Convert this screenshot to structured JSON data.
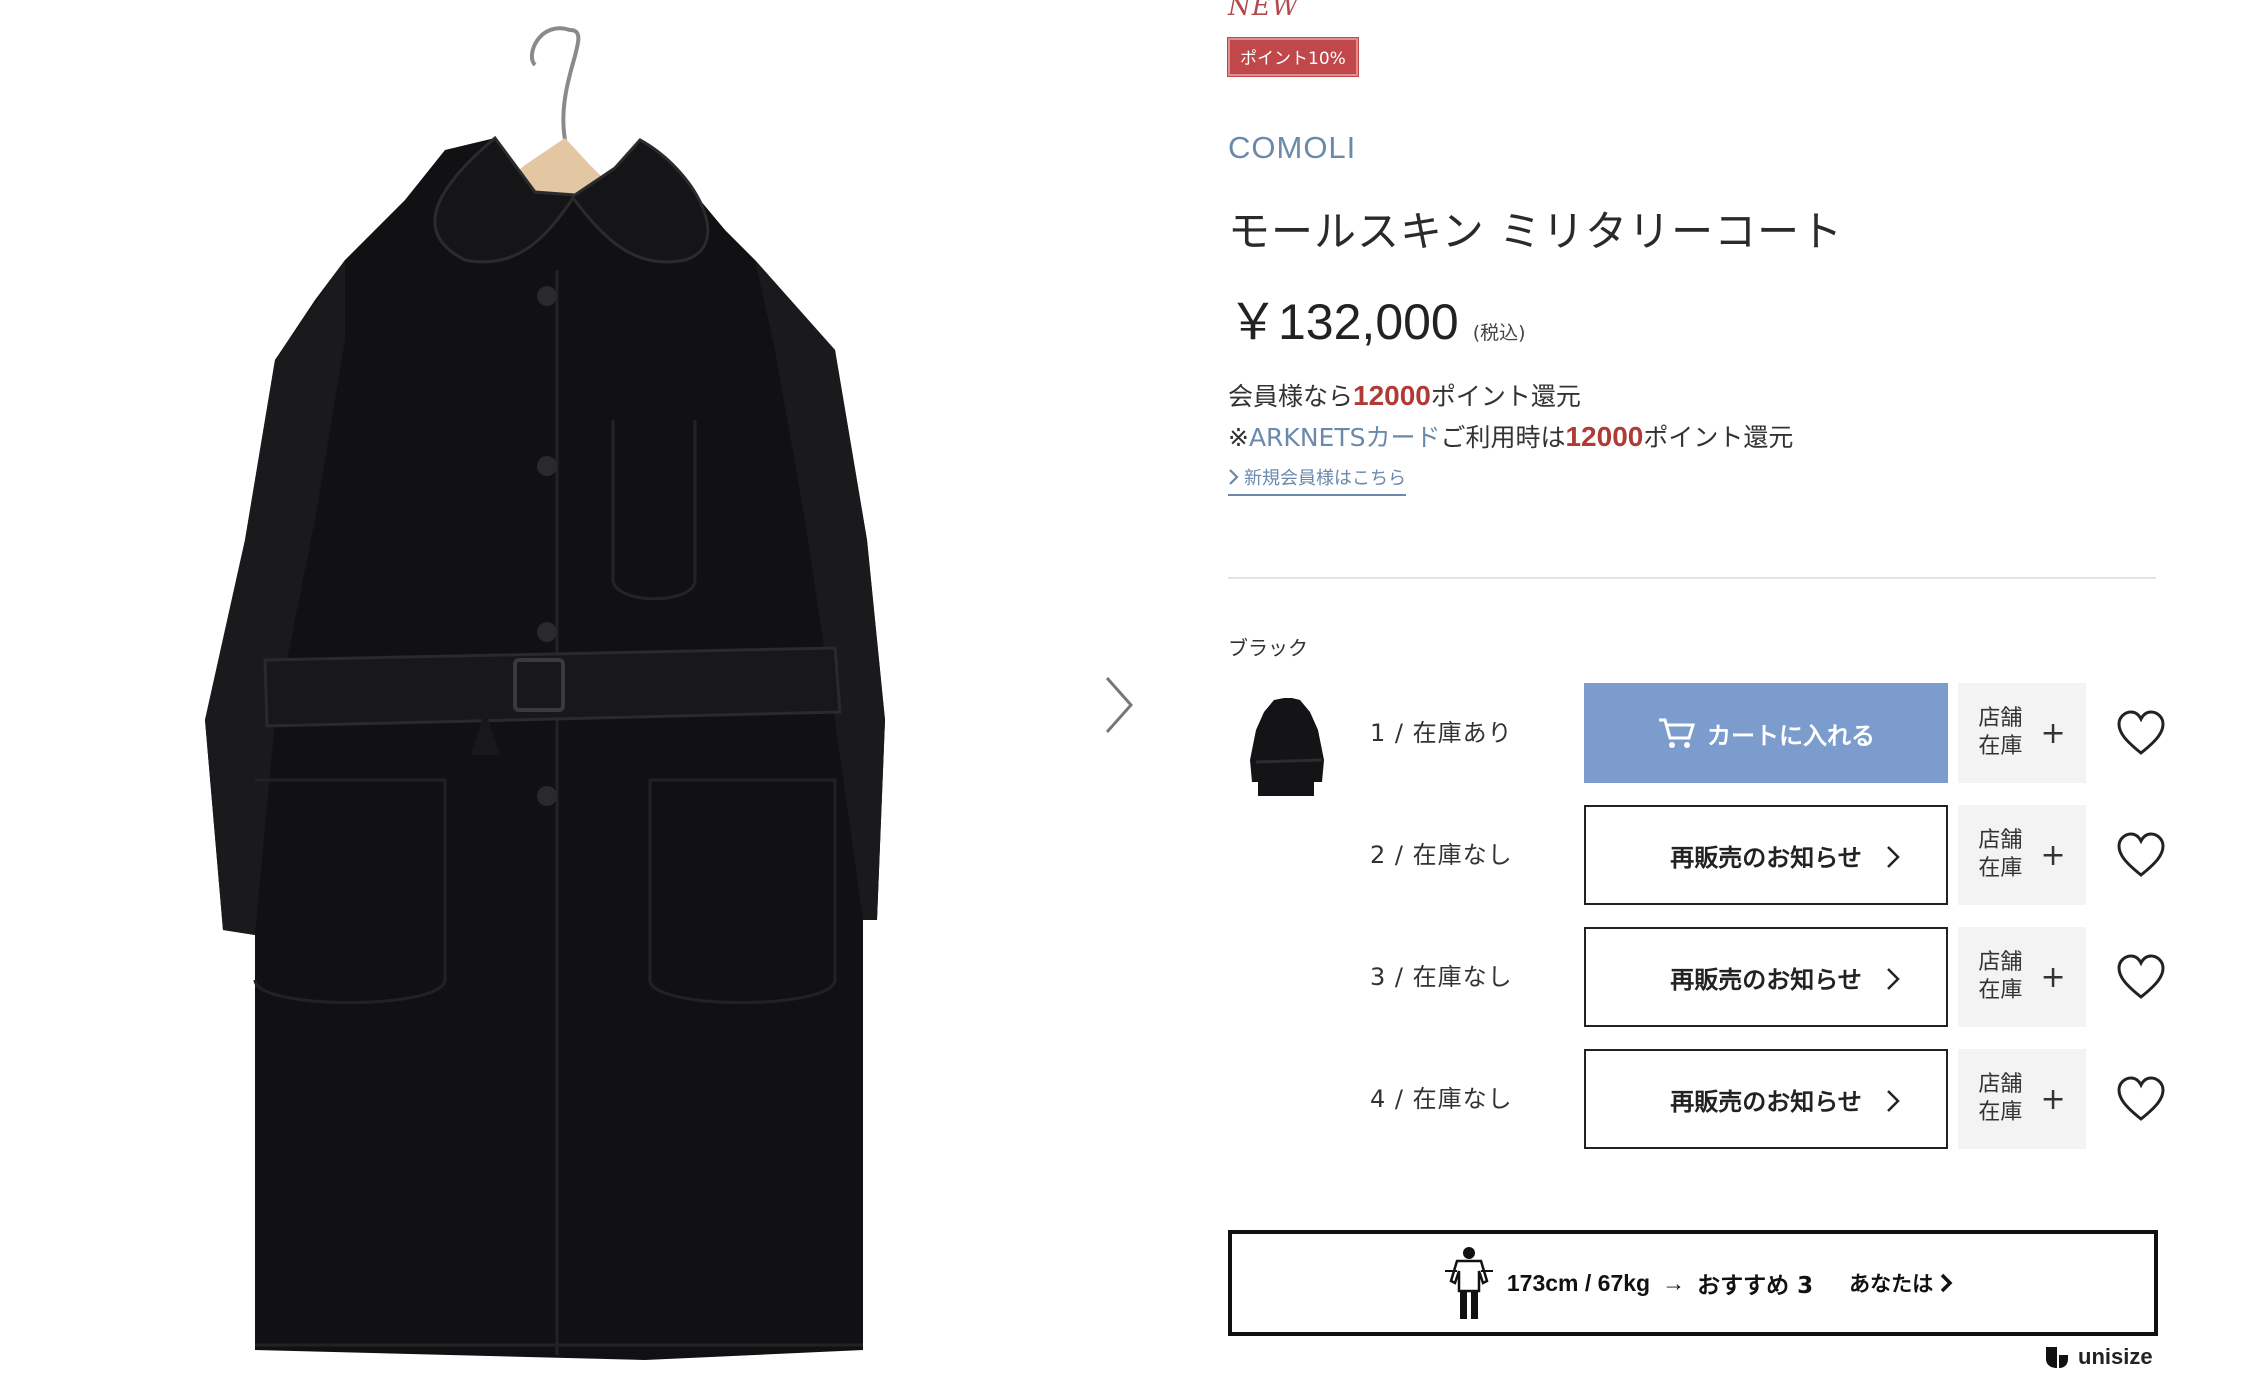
{
  "product": {
    "new_label": "NEW",
    "point_badge": "ポイント10%",
    "brand": "COMOLI",
    "title": "モールスキン ミリタリーコート",
    "price": "￥132,000",
    "tax_note": "(税込)"
  },
  "points": {
    "line1_prefix": "会員様なら",
    "line1_value": "12000",
    "line1_suffix": "ポイント還元",
    "line2_prefix": "※",
    "line2_card": "ARKNETSカード",
    "line2_mid": "ご利用時は",
    "line2_value": "12000",
    "line2_suffix": "ポイント還元",
    "register_link": "新規会員様はこちら"
  },
  "variant": {
    "color_name": "ブラック",
    "sizes": [
      {
        "label": "1 / 在庫あり",
        "action": "カートに入れる",
        "type": "cart"
      },
      {
        "label": "2 / 在庫なし",
        "action": "再販売のお知らせ",
        "type": "notify"
      },
      {
        "label": "3 / 在庫なし",
        "action": "再販売のお知らせ",
        "type": "notify"
      },
      {
        "label": "4 / 在庫なし",
        "action": "再販売のお知らせ",
        "type": "notify"
      }
    ],
    "store_stock_label_1": "店舗",
    "store_stock_label_2": "在庫",
    "store_plus": "+"
  },
  "unisize": {
    "measure": "173cm / 67kg",
    "arrow": "→",
    "recommend": "おすすめ 3",
    "you": "あなたは",
    "logo": "unisize"
  },
  "colors": {
    "brand_blue": "#6a89ab",
    "cart_blue": "#7b9ccc",
    "badge_red": "#c0474a",
    "point_red": "#b03a35"
  }
}
